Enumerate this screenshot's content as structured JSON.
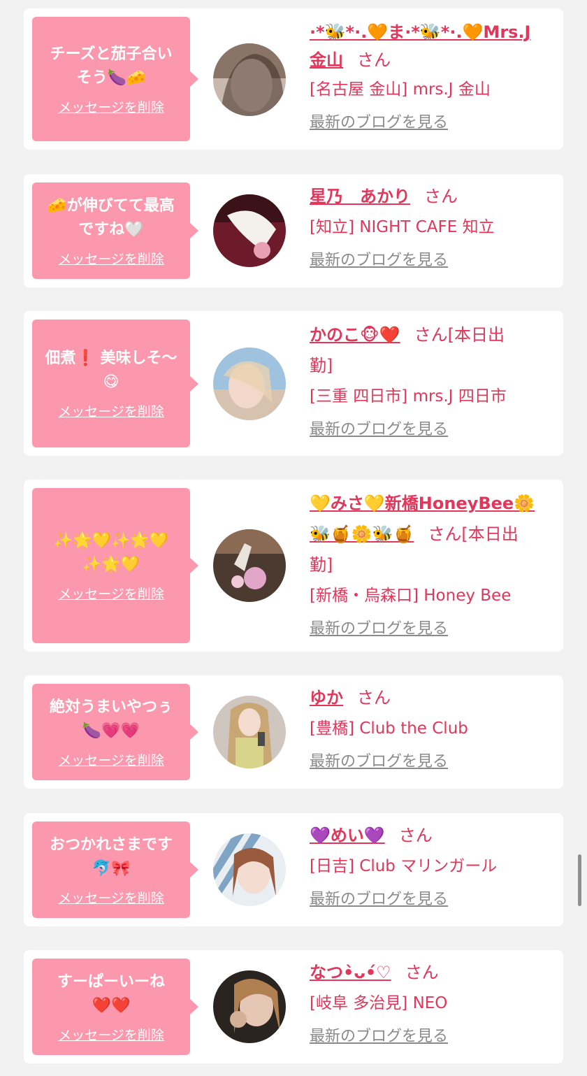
{
  "delete_label": "メッセージを削除",
  "blog_label": "最新のブログを見る",
  "san_label": "さん",
  "cards": [
    {
      "message": "チーズと茄子合い\nそう🍆🧀",
      "name": "·*🐝*·.🧡ま·*🐝*·.🧡Mrs.J\n金山",
      "suffix": "",
      "shop": "[名古屋 金山] mrs.J 金山"
    },
    {
      "message": "🧀が伸びてて最高\nですね🤍",
      "name": "星乃　あかり",
      "suffix": "",
      "shop": "[知立] NIGHT CAFE 知立"
    },
    {
      "message": "佃煮❗️ 美味しそ〜\n😋",
      "name": "かのこ🐵❤️",
      "suffix": "[本日出\n勤]",
      "shop": "[三重 四日市] mrs.J 四日市"
    },
    {
      "message": "✨🌟💛✨🌟💛\n✨🌟💛",
      "name": "💛みさ💛新橋HoneyBee🌼\n🐝🍯🌼🐝🍯",
      "suffix": "[本日出\n勤]",
      "shop": "[新橋・烏森口] Honey Bee"
    },
    {
      "message": "絶対うまいやつぅ\n🍆💗💗",
      "name": "ゆか",
      "suffix": "",
      "shop": "[豊橋] Club the Club"
    },
    {
      "message": "おつかれさまです\n🐬🎀",
      "name": "💜めい💜",
      "suffix": "",
      "shop": "[日吉] Club マリンガール"
    },
    {
      "message": "すーぱーいーね\n❤️❤️",
      "name": "なつ•̀ᴗ•́♡",
      "suffix": "",
      "shop": "[岐阜 多治見] NEO"
    }
  ]
}
